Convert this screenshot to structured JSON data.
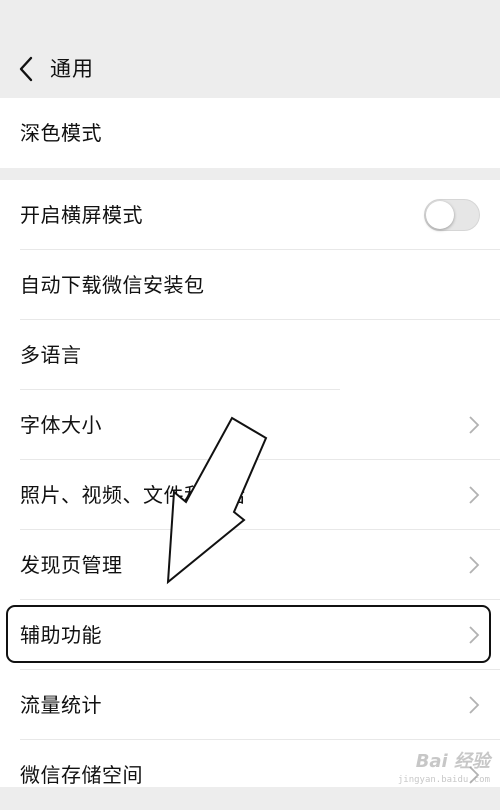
{
  "header": {
    "title": "通用",
    "back_icon": "chevron-left-icon"
  },
  "dark_mode": {
    "label": "深色模式"
  },
  "settings": {
    "landscape_label": "开启横屏模式",
    "landscape_enabled": false,
    "items": [
      {
        "label": "自动下载微信安装包"
      },
      {
        "label": "多语言"
      },
      {
        "label": "字体大小"
      },
      {
        "label": "照片、视频、文件和通话"
      },
      {
        "label": "发现页管理"
      },
      {
        "label": "辅助功能"
      },
      {
        "label": "流量统计"
      },
      {
        "label": "微信存储空间"
      }
    ]
  },
  "annotation": {
    "highlighted_item": "辅助功能",
    "arrow_icon": "pointer-arrow-icon"
  },
  "watermark": {
    "brand": "Bai 经验",
    "url": "jingyan.baidu.com"
  },
  "colors": {
    "background": "#ededed",
    "row_background": "#ffffff",
    "text": "#111111",
    "chevron": "#b2b2b2",
    "toggle_off": "#e6e6e6"
  }
}
